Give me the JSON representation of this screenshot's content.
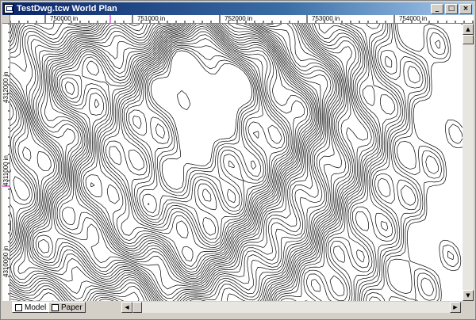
{
  "window": {
    "title": "TestDwg.tcw World Plan",
    "buttons": {
      "minimize": "_",
      "maximize": "□",
      "close": "×"
    }
  },
  "ruler": {
    "x_labels": [
      "750000 in",
      "751000 in",
      "752000 in",
      "753000 in",
      "754000 in"
    ],
    "y_labels": [
      "4312000 in",
      "4311000 in",
      "4310000 in"
    ]
  },
  "tabs": {
    "model": "Model",
    "paper": "Paper"
  },
  "icons": {
    "app": "drawing-icon",
    "model_tab": "model-space-icon",
    "paper_tab": "paper-space-icon"
  },
  "colors": {
    "titlebar": "#0a246a",
    "contour": "#000000",
    "canvas": "#ffffff"
  }
}
